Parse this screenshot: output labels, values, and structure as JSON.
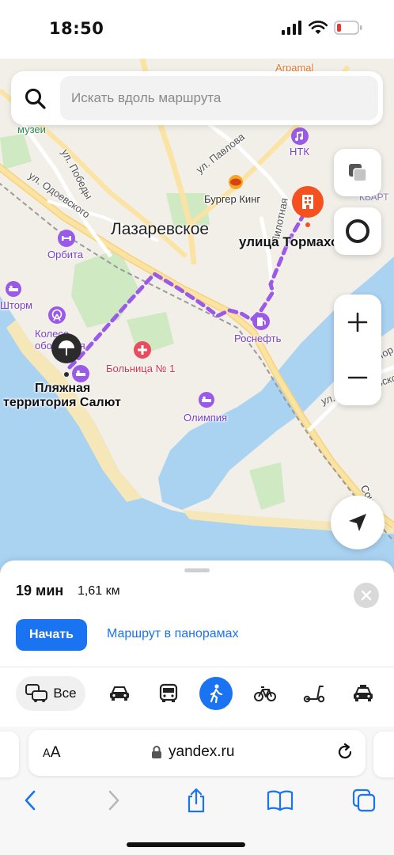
{
  "status_bar": {
    "time": "18:50",
    "battery_color": "#e53935"
  },
  "search": {
    "placeholder": "Искать вдоль маршрута"
  },
  "map": {
    "town": "Лазаревское",
    "streets": [
      "ул. Победы",
      "ул. Одоевского",
      "ул. Павлова",
      "Пилотная",
      "ул. Малышевского",
      "Сочи",
      "Мор"
    ],
    "pois": {
      "arpamal": "Arpamal",
      "museums": "музеи",
      "ntk": "НТК",
      "burger_king": "Бургер Кинг",
      "orbita": "Орбита",
      "storm": "Шторм",
      "koleso": "Колесо обозрения",
      "hospital": "Больница № 1",
      "rosneft": "Роснефть",
      "olimpia": "Олимпия",
      "kvart": "КВАРТ",
      "destination": "улица Тормахова",
      "origin_line1": "Пляжная",
      "origin_line2": "территория Салют"
    },
    "route_color": "#9b59e8",
    "destination_color": "#f4511e"
  },
  "route": {
    "time": "19 мин",
    "distance": "1,61 км",
    "start_label": "Начать",
    "panorama_label": "Маршрут в панорамах"
  },
  "modes": {
    "all_label": "Все",
    "active": "walk",
    "accent": "#1a73f0"
  },
  "browser": {
    "text_size_small": "A",
    "text_size_large": "A",
    "url": "yandex.ru"
  }
}
